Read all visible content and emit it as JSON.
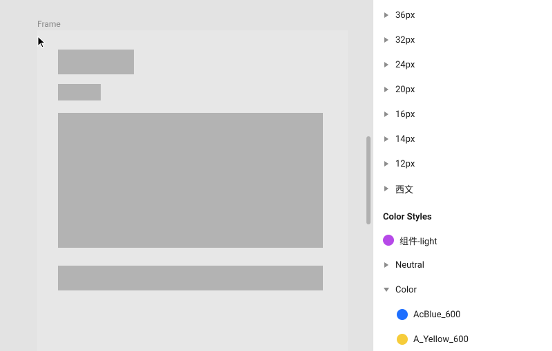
{
  "canvas": {
    "frame_label": "Frame"
  },
  "panel": {
    "text_styles": [
      "36px",
      "32px",
      "24px",
      "20px",
      "16px",
      "14px",
      "12px",
      "西文"
    ],
    "color_section_title": "Color Styles",
    "color_items": {
      "light": "组件-light",
      "neutral": "Neutral",
      "color": "Color",
      "acblue": "AcBlue_600",
      "ayellow": "A_Yellow_600"
    }
  }
}
